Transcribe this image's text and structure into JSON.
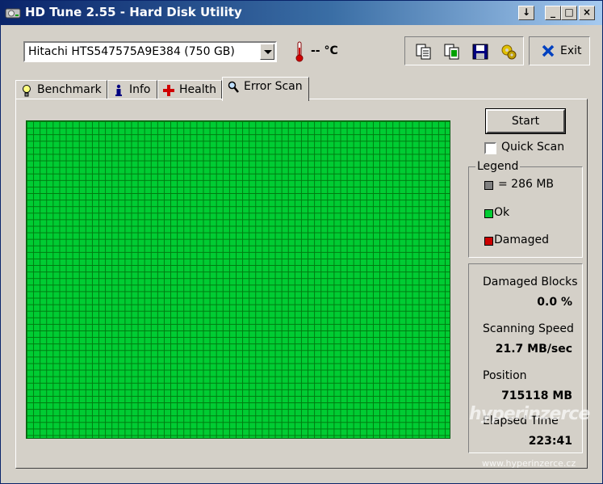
{
  "window": {
    "title": "HD Tune 2.55 - Hard Disk Utility",
    "buttons": {
      "down": "↓",
      "minimize": "_",
      "maximize": "□",
      "close": "×"
    }
  },
  "toolbar": {
    "drive": "Hitachi HTS547575A9E384 (750 GB)",
    "temperature": "-- °C",
    "exit_label": "Exit",
    "icons": [
      "copy-text-icon",
      "copy-screenshot-icon",
      "save-icon",
      "options-icon",
      "exit-icon"
    ]
  },
  "tabs": [
    {
      "label": "Benchmark",
      "icon": "lightbulb-icon",
      "active": false
    },
    {
      "label": "Info",
      "icon": "info-icon",
      "active": false
    },
    {
      "label": "Health",
      "icon": "health-cross-icon",
      "active": false
    },
    {
      "label": "Error Scan",
      "icon": "magnifier-icon",
      "active": true
    }
  ],
  "scan": {
    "start_label": "Start",
    "quick_scan_label": "Quick Scan",
    "quick_scan_checked": false,
    "block_state": "ok"
  },
  "legend": {
    "title": "Legend",
    "items": [
      {
        "label": "= 286 MB",
        "color": "#808080"
      },
      {
        "label": "Ok",
        "color": "#00cc33"
      },
      {
        "label": "Damaged",
        "color": "#cc0000"
      }
    ]
  },
  "stats": {
    "damaged_blocks_label": "Damaged Blocks",
    "damaged_blocks_value": "0.0 %",
    "scanning_speed_label": "Scanning Speed",
    "scanning_speed_value": "21.7 MB/sec",
    "position_label": "Position",
    "position_value": "715118 MB",
    "elapsed_time_label": "Elapsed Time",
    "elapsed_time_value": "223:41"
  },
  "watermark": {
    "text": "hyperinzerce",
    "url": "www.hyperinzerce.cz"
  },
  "colors": {
    "ok_block": "#00cc33",
    "grid_line": "#007a10",
    "titlebar_start": "#0a246a",
    "face": "#d4d0c8"
  }
}
